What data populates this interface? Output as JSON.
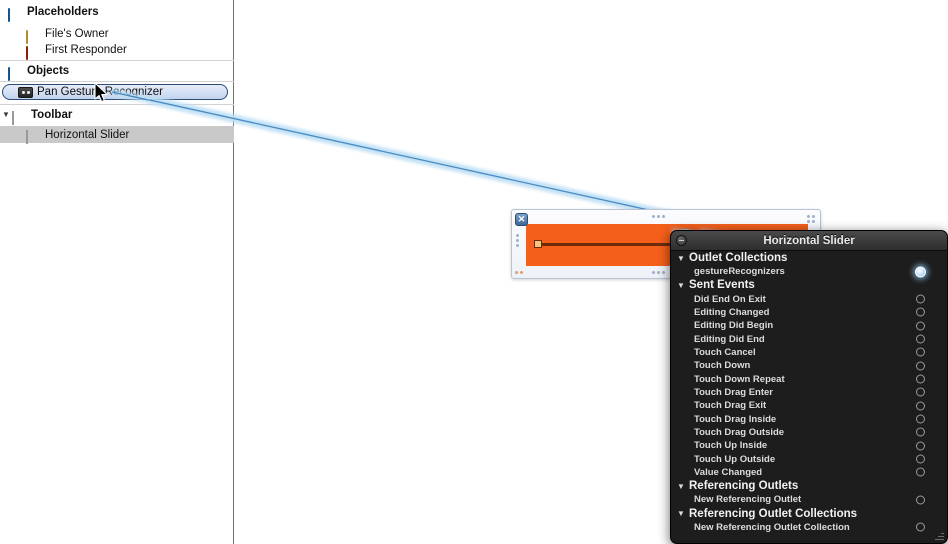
{
  "outline": {
    "sections": [
      {
        "label": "Placeholders",
        "icon": "cube-blue-icon",
        "disclosure": "",
        "items": [
          {
            "label": "File's Owner",
            "icon": "cube-tan-icon"
          },
          {
            "label": "First Responder",
            "icon": "cube-red-icon"
          }
        ]
      },
      {
        "label": "Objects",
        "icon": "cube-blue-icon",
        "disclosure": "",
        "items": [
          {
            "label": "Pan Gesture Recognizer",
            "icon": "gesture-recognizer-icon",
            "selected": true
          }
        ]
      },
      {
        "label": "Toolbar",
        "icon": "white-square-icon",
        "disclosure": "▼",
        "items": [
          {
            "label": "Horizontal Slider",
            "icon": "white-square-icon",
            "highlighted": true
          }
        ]
      }
    ]
  },
  "canvas": {
    "slider": {
      "name": "Horizontal Slider",
      "close_badge": "✕",
      "value_percent": 0,
      "fill_color": "#f4601c",
      "track_color": "#6d2b0b"
    }
  },
  "connections_panel": {
    "title": "Horizontal Slider",
    "close_icon": "close-icon",
    "triangle": "▼",
    "sections": [
      {
        "name": "Outlet Collections",
        "rows": [
          {
            "label": "gestureRecognizers",
            "connected": true
          }
        ]
      },
      {
        "name": "Sent Events",
        "rows": [
          {
            "label": "Did End On Exit",
            "connected": false
          },
          {
            "label": "Editing Changed",
            "connected": false
          },
          {
            "label": "Editing Did Begin",
            "connected": false
          },
          {
            "label": "Editing Did End",
            "connected": false
          },
          {
            "label": "Touch Cancel",
            "connected": false
          },
          {
            "label": "Touch Down",
            "connected": false
          },
          {
            "label": "Touch Down Repeat",
            "connected": false
          },
          {
            "label": "Touch Drag Enter",
            "connected": false
          },
          {
            "label": "Touch Drag Exit",
            "connected": false
          },
          {
            "label": "Touch Drag Inside",
            "connected": false
          },
          {
            "label": "Touch Drag Outside",
            "connected": false
          },
          {
            "label": "Touch Up Inside",
            "connected": false
          },
          {
            "label": "Touch Up Outside",
            "connected": false
          },
          {
            "label": "Value Changed",
            "connected": false
          }
        ]
      },
      {
        "name": "Referencing Outlets",
        "rows": [
          {
            "label": "New Referencing Outlet",
            "connected": false
          }
        ]
      },
      {
        "name": "Referencing Outlet Collections",
        "rows": [
          {
            "label": "New Referencing Outlet Collection",
            "connected": false
          }
        ]
      }
    ]
  },
  "colors": {
    "wire": "#4a8fc4",
    "wire_glow": "#bfe0f5",
    "selection": "#c2d3ee",
    "panel_bg": "#1d1d1d",
    "slider_orange": "#f4601c"
  }
}
